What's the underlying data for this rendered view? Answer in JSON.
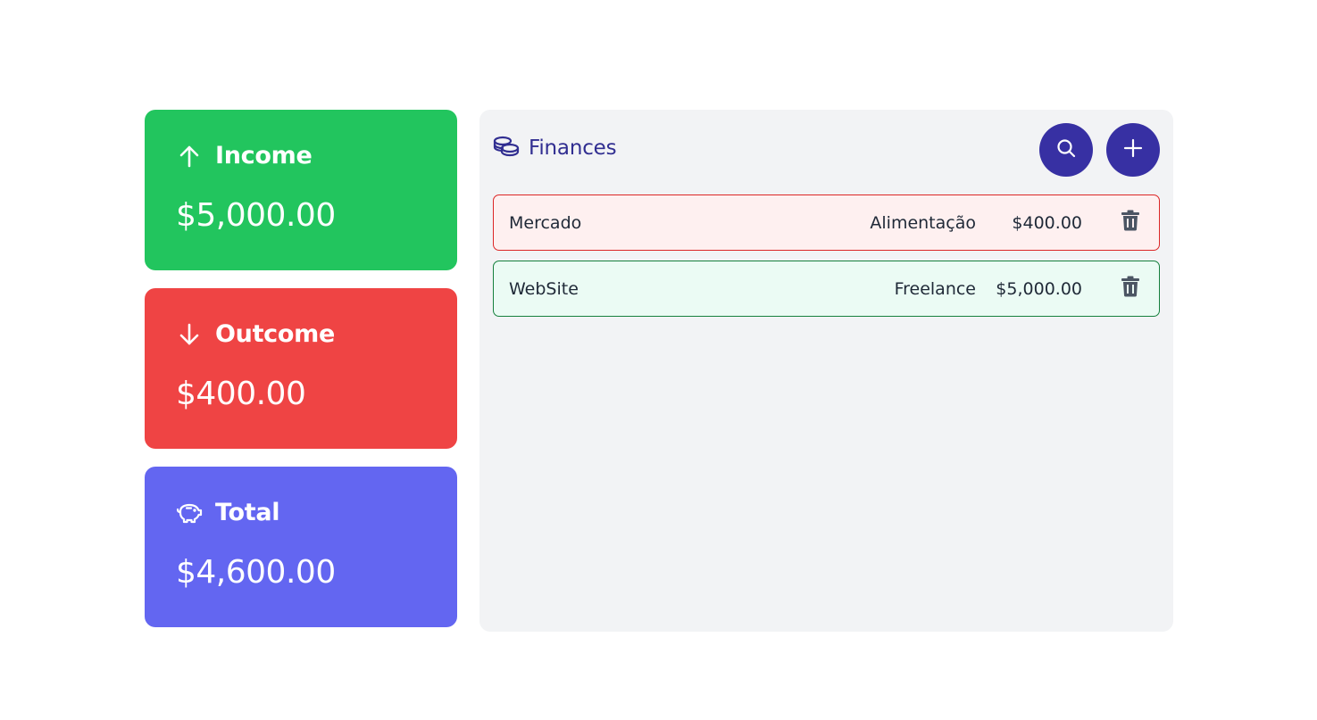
{
  "summary": {
    "income": {
      "label": "Income",
      "value": "$5,000.00",
      "icon": "arrow-up-icon",
      "color": "#22c55e"
    },
    "outcome": {
      "label": "Outcome",
      "value": "$400.00",
      "icon": "arrow-down-icon",
      "color": "#ef4444"
    },
    "total": {
      "label": "Total",
      "value": "$4,600.00",
      "icon": "piggy-bank-icon",
      "color": "#6366f1"
    }
  },
  "finances": {
    "title": "Finances",
    "title_icon": "coins-icon",
    "accent_color": "#3730a3",
    "search_button_icon": "search-icon",
    "add_button_icon": "plus-icon",
    "transactions": [
      {
        "name": "Mercado",
        "category": "Alimentação",
        "amount": "$400.00",
        "type": "expense",
        "delete_icon": "trash-icon"
      },
      {
        "name": "WebSite",
        "category": "Freelance",
        "amount": "$5,000.00",
        "type": "income",
        "delete_icon": "trash-icon"
      }
    ]
  }
}
